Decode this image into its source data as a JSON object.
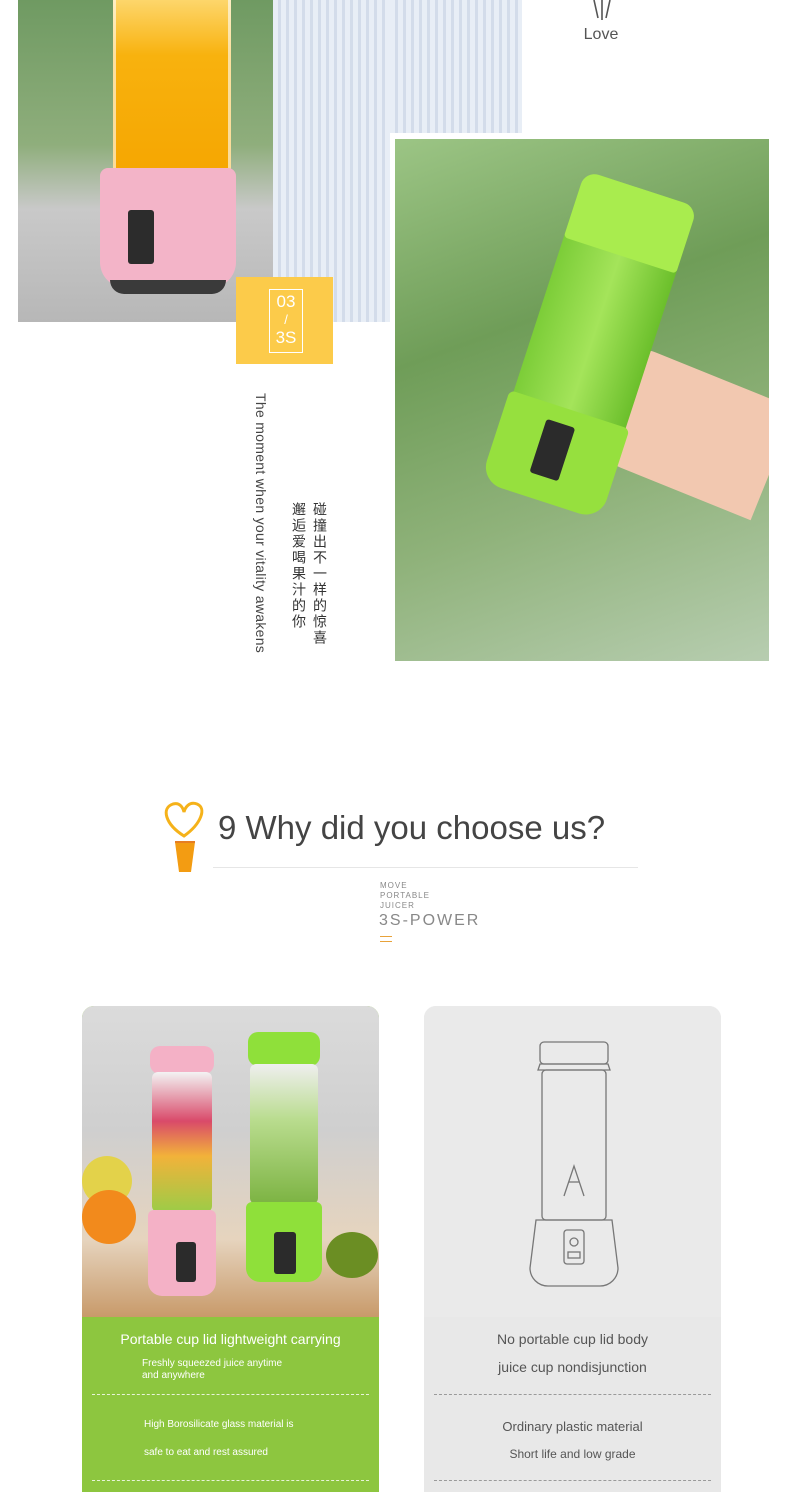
{
  "top": {
    "badge": {
      "number": "03",
      "slash": "/",
      "code": "3S"
    },
    "love_label": "Love",
    "tagline_en": "The moment when your vitality awakens",
    "tagline_cn_line1": "碰撞出不一样的惊喜",
    "tagline_cn_line2": "邂逅爱喝果汁的你"
  },
  "section": {
    "heading": "9 Why did you choose us?",
    "brand_small": [
      "MOVE",
      "PORTABLE",
      "JUICER"
    ],
    "brand_main": "3S-POWER"
  },
  "cards": {
    "left": {
      "title": "Portable cup lid lightweight carrying",
      "point1_line1": "Freshly squeezed juice anytime",
      "point1_line2": "and anywhere",
      "point2_line1": "High Borosilicate glass material is",
      "point2_line2": "safe to eat and rest assured"
    },
    "right": {
      "title_line1": "No portable cup lid body",
      "title_line2": "juice cup nondisjunction",
      "point1": "Ordinary plastic material",
      "point2": "Short life and low grade"
    }
  },
  "colors": {
    "badge_yellow": "#fccb4a",
    "card_green": "#8dc63f",
    "card_gray": "#e8e8e8",
    "heading_text": "#444444"
  }
}
